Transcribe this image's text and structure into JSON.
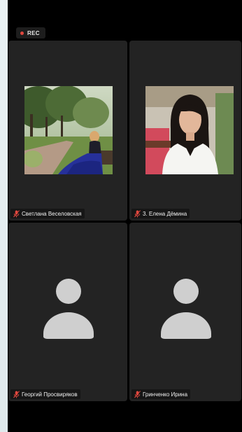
{
  "recording": {
    "label": "REC"
  },
  "participants": [
    {
      "name": "Светлана Веселовская",
      "muted": true,
      "video": "photo-park"
    },
    {
      "name": "3. Елена Дёмина",
      "muted": true,
      "video": "photo-selfie"
    },
    {
      "name": "Георгий Просвиряков",
      "muted": true,
      "video": "avatar-placeholder"
    },
    {
      "name": "Гринченко Ирина",
      "muted": true,
      "video": "avatar-placeholder"
    }
  ],
  "colors": {
    "muted_mic": "#e0473e",
    "tile_bg": "#232323",
    "avatar": "#cfcfcf"
  }
}
